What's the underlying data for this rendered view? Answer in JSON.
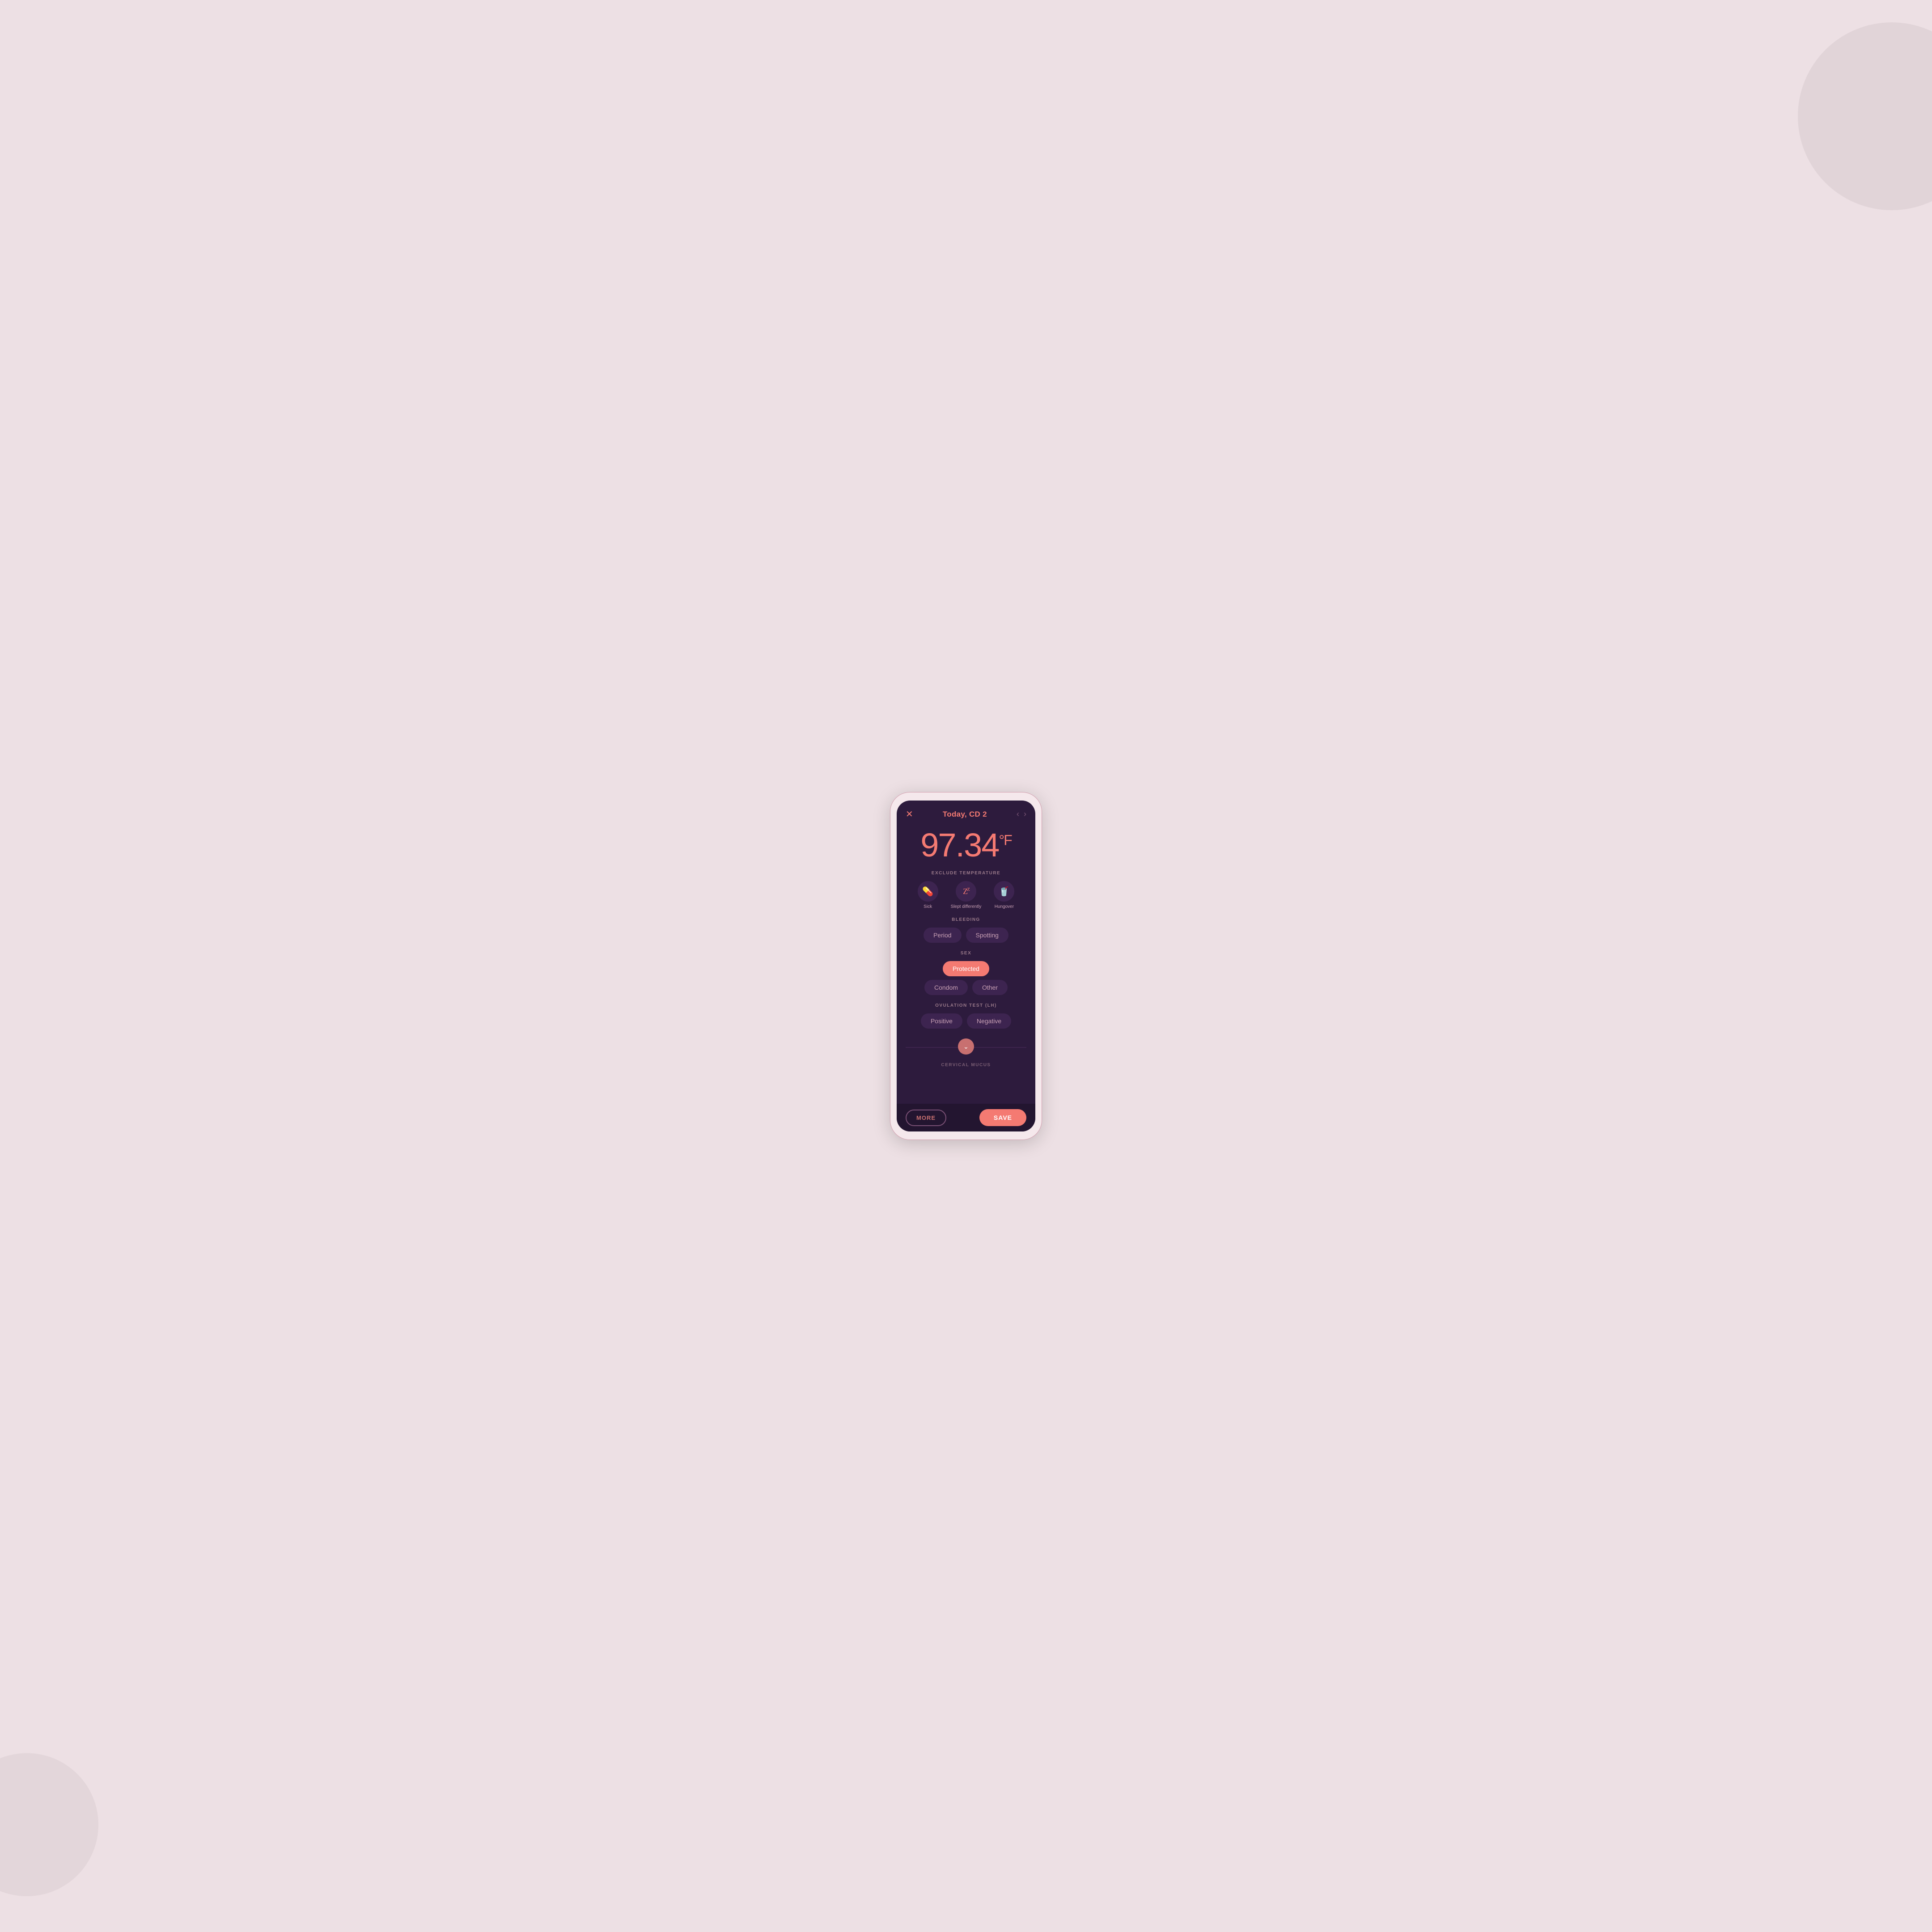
{
  "background": {
    "color": "#ede0e4"
  },
  "header": {
    "close_icon": "✕",
    "title": "Today, CD 2",
    "nav_back": "‹",
    "nav_forward": "›"
  },
  "temperature": {
    "value": "97.34",
    "unit": "°F"
  },
  "exclude_temperature": {
    "label": "EXCLUDE TEMPERATURE",
    "items": [
      {
        "id": "sick",
        "icon": "💊",
        "label": "Sick"
      },
      {
        "id": "slept-differently",
        "icon": "💤",
        "label": "Slept differently"
      },
      {
        "id": "hungover",
        "icon": "🥤",
        "label": "Hungover"
      }
    ]
  },
  "bleeding": {
    "label": "BLEEDING",
    "options": [
      {
        "id": "period",
        "label": "Period",
        "active": false
      },
      {
        "id": "spotting",
        "label": "Spotting",
        "active": false
      }
    ]
  },
  "sex": {
    "label": "SEX",
    "protected_label": "Protected",
    "sub_options": [
      {
        "id": "condom",
        "label": "Condom",
        "active": false
      },
      {
        "id": "other",
        "label": "Other",
        "active": false
      }
    ],
    "protected_active": true
  },
  "ovulation_test": {
    "label": "OVULATION TEST (LH)",
    "options": [
      {
        "id": "positive",
        "label": "Positive",
        "active": false
      },
      {
        "id": "negative",
        "label": "Negative",
        "active": false
      }
    ]
  },
  "cervical_mucus": {
    "label": "CERVICAL MUCUS"
  },
  "bottom_bar": {
    "more_label": "MORE",
    "save_label": "SAVE"
  }
}
